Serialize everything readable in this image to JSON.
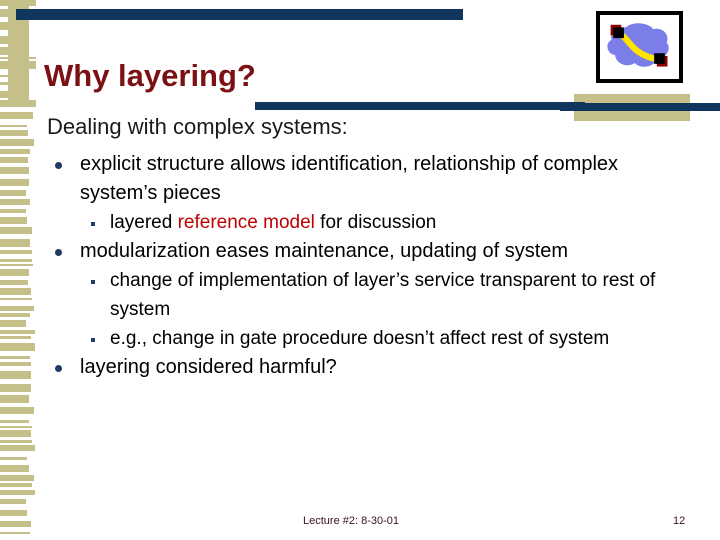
{
  "slide": {
    "title": "Why layering?",
    "subtitle": "Dealing with complex systems:",
    "bullets": [
      {
        "level": 1,
        "text": "explicit structure allows identification, relationship of complex system’s pieces"
      },
      {
        "level": 2,
        "text_before": "layered ",
        "highlight": "reference model",
        "text_after": " for discussion"
      },
      {
        "level": 1,
        "text": "modularization eases maintenance, updating of system"
      },
      {
        "level": 2,
        "text": "change of implementation of layer’s service transparent to rest of system"
      },
      {
        "level": 2,
        "text": "e.g., change in gate procedure doesn’t affect rest of system"
      },
      {
        "level": 1,
        "text": "layering considered harmful?"
      }
    ]
  },
  "footer": {
    "note": "Lecture #2: 8-30-01",
    "page": "12"
  },
  "decor": {
    "logo_name": "network-cloud-logo",
    "stripe_color": "#c5c08a",
    "rule_color": "#10365e",
    "title_color": "#7b1113",
    "highlight_color": "#c00000",
    "cloud_color": "#7b7ee8",
    "link_color": "#ffe400",
    "node_color": "#000000",
    "node_shadow_color": "#8b0000"
  }
}
